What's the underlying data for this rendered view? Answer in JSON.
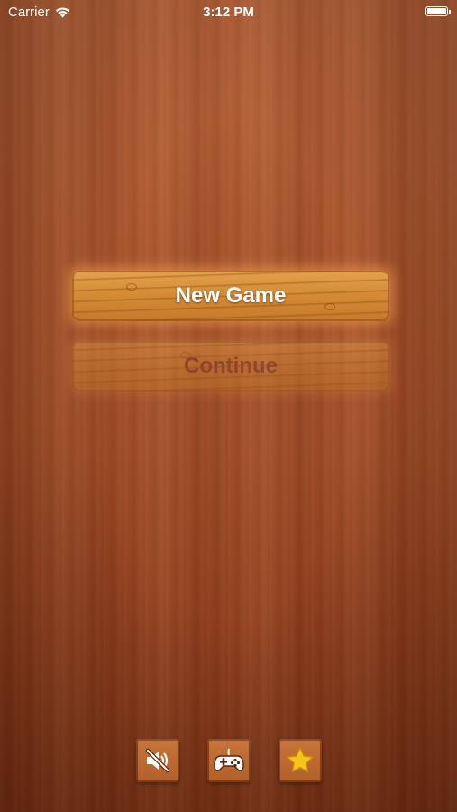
{
  "status_bar": {
    "carrier": "Carrier",
    "time": "3:12 PM",
    "battery_level": 1.0
  },
  "menu": {
    "new_game_label": "New Game",
    "continue_label": "Continue",
    "continue_enabled": false
  },
  "toolbar": {
    "items": [
      {
        "icon": "speaker-muted-icon"
      },
      {
        "icon": "gamepad-icon"
      },
      {
        "icon": "star-icon"
      }
    ]
  },
  "colors": {
    "background": "#a9552c",
    "plank": "#d48a34",
    "label_active": "#ffffff",
    "label_disabled": "#7a3a2a",
    "star": "#f5c518"
  }
}
